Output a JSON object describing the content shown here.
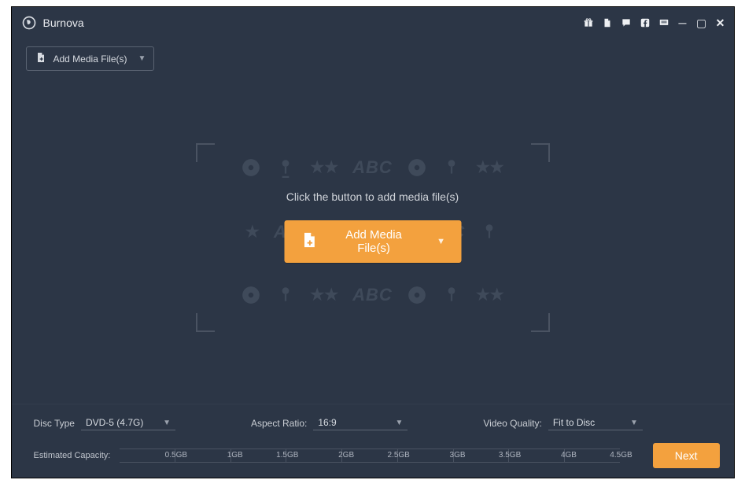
{
  "app": {
    "title": "Burnova"
  },
  "titlebar_icons": [
    "gift-icon",
    "document-icon",
    "chat-icon",
    "facebook-icon",
    "feedback-icon",
    "minimize-icon",
    "maximize-icon",
    "close-icon"
  ],
  "toolbar": {
    "add_media_label": "Add Media File(s)"
  },
  "main": {
    "prompt": "Click the button to add media file(s)",
    "add_button_label": "Add Media File(s)"
  },
  "footer": {
    "disc_type_label": "Disc Type",
    "disc_type_value": "DVD-5 (4.7G)",
    "aspect_ratio_label": "Aspect Ratio:",
    "aspect_ratio_value": "16:9",
    "video_quality_label": "Video Quality:",
    "video_quality_value": "Fit to Disc",
    "capacity_label": "Estimated Capacity:",
    "capacity_ticks": [
      "0.5GB",
      "1GB",
      "1.5GB",
      "2GB",
      "2.5GB",
      "3GB",
      "3.5GB",
      "4GB",
      "4.5GB"
    ],
    "next_label": "Next"
  }
}
